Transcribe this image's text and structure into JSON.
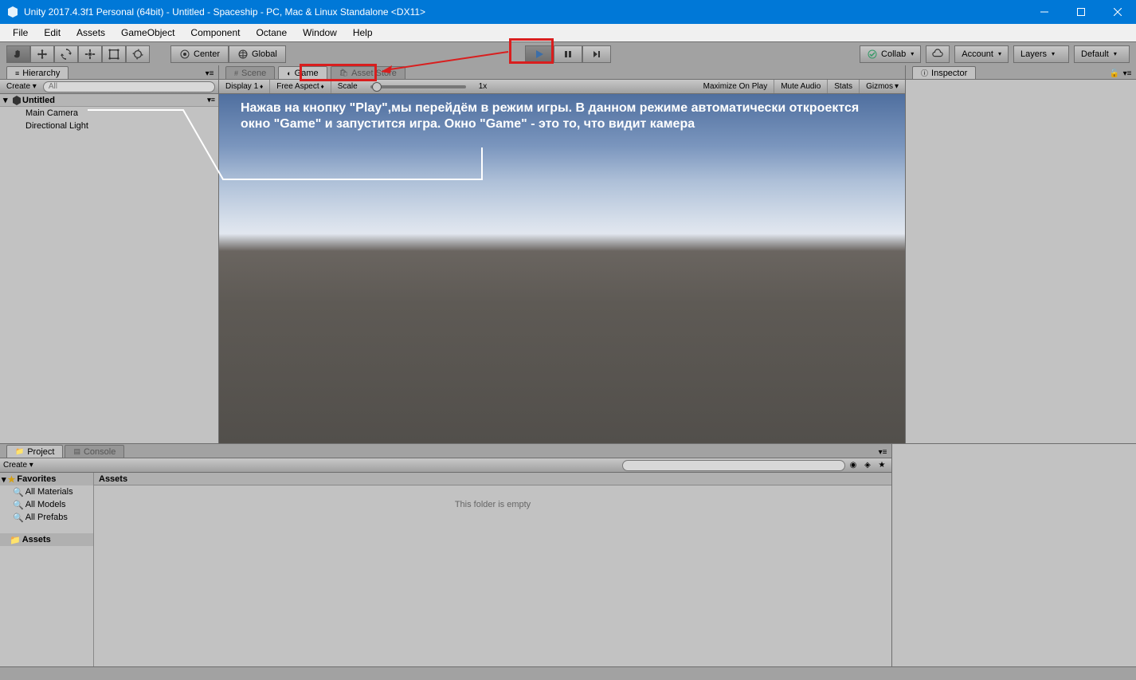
{
  "window": {
    "title": "Unity 2017.4.3f1 Personal (64bit) - Untitled - Spaceship - PC, Mac & Linux Standalone <DX11>"
  },
  "menu": {
    "items": [
      "File",
      "Edit",
      "Assets",
      "GameObject",
      "Component",
      "Octane",
      "Window",
      "Help"
    ]
  },
  "toolbar": {
    "center": "Center",
    "global": "Global",
    "collab": "Collab",
    "account": "Account",
    "layers": "Layers",
    "layout": "Default"
  },
  "hierarchy": {
    "tab": "Hierarchy",
    "create": "Create",
    "search_placeholder": "All",
    "scene": "Untitled",
    "items": [
      "Main Camera",
      "Directional Light"
    ]
  },
  "center": {
    "tabs": {
      "scene": "Scene",
      "game": "Game",
      "assetstore": "Asset Store"
    },
    "game_toolbar": {
      "display": "Display 1",
      "aspect": "Free Aspect",
      "scale": "Scale",
      "scale_value": "1x",
      "maximize": "Maximize On Play",
      "mute": "Mute Audio",
      "stats": "Stats",
      "gizmos": "Gizmos"
    }
  },
  "inspector": {
    "tab": "Inspector"
  },
  "project": {
    "tabs": {
      "project": "Project",
      "console": "Console"
    },
    "create": "Create",
    "search_placeholder": "",
    "favorites": "Favorites",
    "fav_items": [
      "All Materials",
      "All Models",
      "All Prefabs"
    ],
    "assets": "Assets",
    "breadcrumb": "Assets",
    "empty": "This folder is empty"
  },
  "annotation": {
    "text": "Нажав на кнопку \"Play\",мы перейдём в режим игры. В данном режиме автоматически  откроектся окно \"Game\" и запустится игра. Окно \"Game\" - это то, что видит камера"
  }
}
